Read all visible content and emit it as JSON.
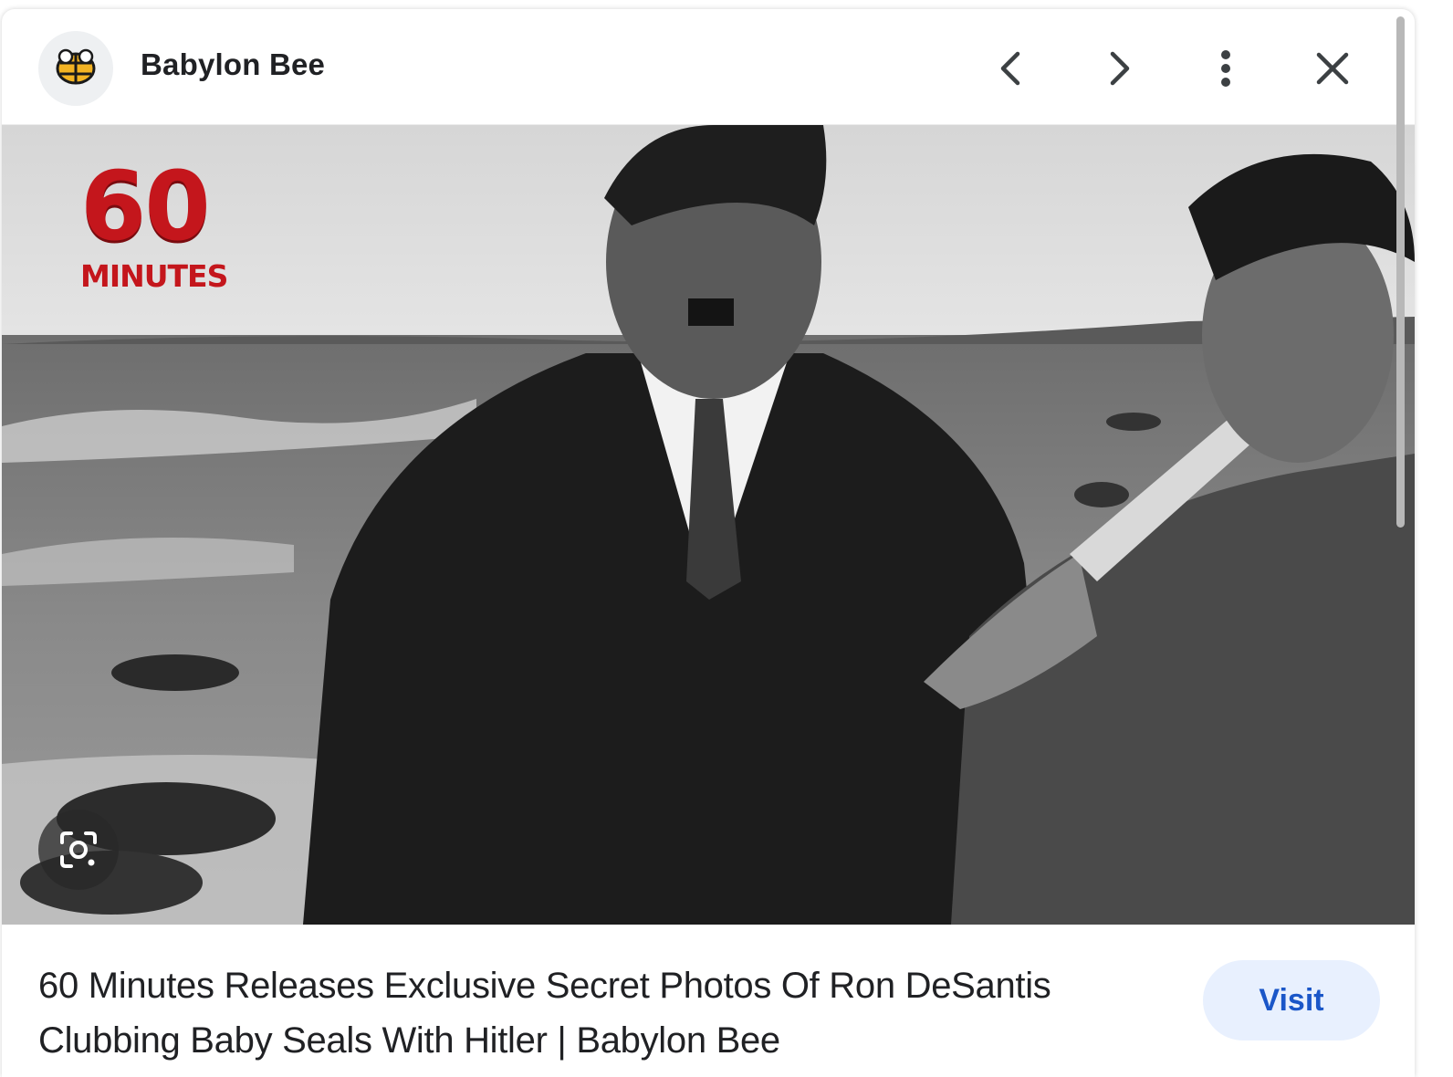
{
  "header": {
    "source_name": "Babylon Bee",
    "logo_icon": "bee-logo-icon",
    "prev_icon": "chevron-left-icon",
    "next_icon": "chevron-right-icon",
    "more_icon": "more-vert-icon",
    "close_icon": "close-icon"
  },
  "image": {
    "brand_number": "60",
    "brand_word": "MINUTES",
    "brand_color": "#c4161c",
    "lens_icon": "google-lens-icon"
  },
  "caption": {
    "title": "60 Minutes Releases Exclusive Secret Photos Of Ron DeSantis Clubbing Baby Seals With Hitler | Babylon Bee"
  },
  "actions": {
    "visit_label": "Visit",
    "visit_bg": "#e8f0fe",
    "visit_color": "#1a56c8"
  }
}
